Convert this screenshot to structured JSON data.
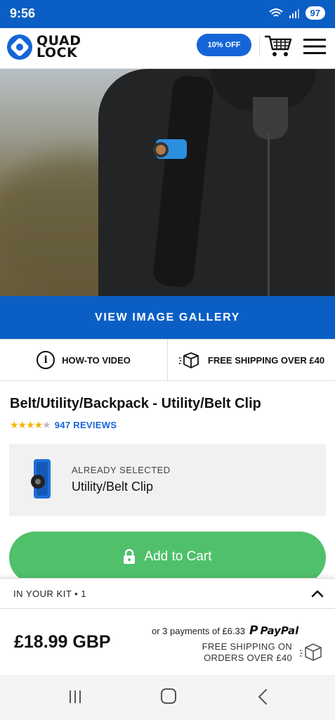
{
  "status_bar": {
    "time": "9:56",
    "battery": "97"
  },
  "header": {
    "logo_line1": "QUAD",
    "logo_line2": "LOCK",
    "promo_label": "10% OFF"
  },
  "gallery": {
    "label": "VIEW IMAGE GALLERY"
  },
  "info": {
    "video_label": "HOW-TO VIDEO",
    "shipping_label": "FREE SHIPPING OVER £40"
  },
  "product": {
    "title": "Belt/Utility/Backpack - Utility/Belt Clip",
    "rating": 4,
    "rating_max": 5,
    "reviews": "947 REVIEWS"
  },
  "selection": {
    "label": "ALREADY SELECTED",
    "value": "Utility/Belt Clip"
  },
  "cart": {
    "add_label": "Add to Cart"
  },
  "kit": {
    "label": "IN YOUR KIT • 1"
  },
  "footer": {
    "price": "£18.99 GBP",
    "installments": "or 3 payments of £6.33",
    "paypal": "PayPal",
    "shipping_line1": "FREE SHIPPING ON",
    "shipping_line2": "ORDERS OVER £40"
  },
  "colors": {
    "brand_blue": "#0b5fc4",
    "accent_blue": "#1565d8",
    "cart_green": "#50c06b",
    "star_gold": "#f4b400"
  },
  "icons": [
    "wifi-icon",
    "signal-icon",
    "cart-icon",
    "menu-icon",
    "info-icon",
    "box-icon",
    "lock-icon",
    "chevron-up-icon",
    "recents-icon",
    "home-icon",
    "back-icon"
  ]
}
